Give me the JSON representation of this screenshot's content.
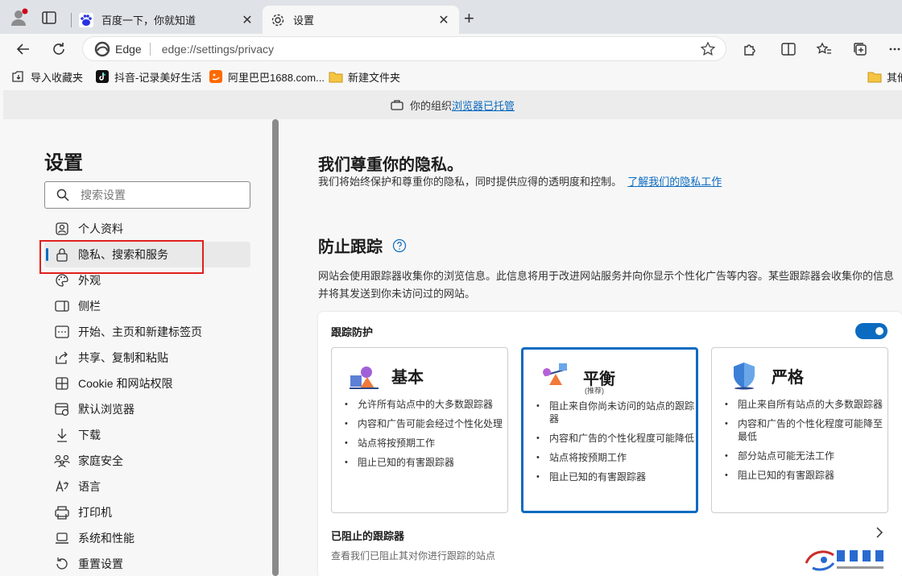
{
  "tabs": {
    "inactive": {
      "title": "百度一下，你就知道",
      "favicon": "baidu-paw-icon"
    },
    "active": {
      "title": "设置",
      "favicon": "gear-icon"
    }
  },
  "address": {
    "site_label": "Edge",
    "url": "edge://settings/privacy"
  },
  "bookmarks": [
    {
      "label": "导入收藏夹",
      "icon": "import-icon"
    },
    {
      "label": "抖音-记录美好生活",
      "icon": "tiktok-icon"
    },
    {
      "label": "阿里巴巴1688.com...",
      "icon": "alibaba-icon"
    },
    {
      "label": "新建文件夹",
      "icon": "folder-icon"
    },
    {
      "label": "其他",
      "icon": "folder-icon"
    }
  ],
  "managed": {
    "prefix": "你的组织",
    "link": "浏览器已托管"
  },
  "sidebar": {
    "title": "设置",
    "search_placeholder": "搜索设置",
    "items": [
      {
        "label": "个人资料",
        "icon": "profile-icon"
      },
      {
        "label": "隐私、搜索和服务",
        "icon": "lock-icon"
      },
      {
        "label": "外观",
        "icon": "palette-icon"
      },
      {
        "label": "侧栏",
        "icon": "sidebar-icon"
      },
      {
        "label": "开始、主页和新建标签页",
        "icon": "home-icon"
      },
      {
        "label": "共享、复制和粘贴",
        "icon": "share-icon"
      },
      {
        "label": "Cookie 和网站权限",
        "icon": "cookie-icon"
      },
      {
        "label": "默认浏览器",
        "icon": "browser-icon"
      },
      {
        "label": "下载",
        "icon": "download-icon"
      },
      {
        "label": "家庭安全",
        "icon": "family-icon"
      },
      {
        "label": "语言",
        "icon": "language-icon"
      },
      {
        "label": "打印机",
        "icon": "printer-icon"
      },
      {
        "label": "系统和性能",
        "icon": "laptop-icon"
      },
      {
        "label": "重置设置",
        "icon": "reset-icon"
      }
    ]
  },
  "main": {
    "privacy_heading": "我们尊重你的隐私。",
    "privacy_text": "我们将始终保护和尊重你的隐私，同时提供应得的透明度和控制。",
    "privacy_link": "了解我们的隐私工作",
    "tracking_heading": "防止跟踪",
    "tracking_text": "网站会使用跟踪器收集你的浏览信息。此信息将用于改进网站服务并向你显示个性化广告等内容。某些跟踪器会收集你的信息并将其发送到你未访问过的网站。",
    "protection_title": "跟踪防护",
    "options": [
      {
        "name": "基本",
        "recommended": "",
        "bullets": [
          "允许所有站点中的大多数跟踪器",
          "内容和广告可能会经过个性化处理",
          "站点将按预期工作",
          "阻止已知的有害跟踪器"
        ]
      },
      {
        "name": "平衡",
        "recommended": "(推荐)",
        "bullets": [
          "阻止来自你尚未访问的站点的跟踪器",
          "内容和广告的个性化程度可能降低",
          "站点将按预期工作",
          "阻止已知的有害跟踪器"
        ]
      },
      {
        "name": "严格",
        "recommended": "",
        "bullets": [
          "阻止来自所有站点的大多数跟踪器",
          "内容和广告的个性化程度可能降至最低",
          "部分站点可能无法工作",
          "阻止已知的有害跟踪器"
        ]
      }
    ],
    "blocked_title": "已阻止的跟踪器",
    "blocked_sub": "查看我们已阻止其对你进行跟踪的站点"
  },
  "colors": {
    "accent": "#0b6bc0",
    "highlight_box": "#e0201c"
  }
}
